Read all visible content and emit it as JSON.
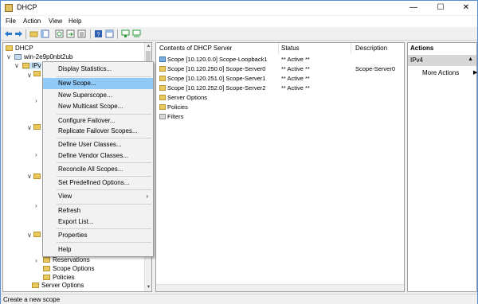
{
  "window": {
    "title": "DHCP"
  },
  "menubar": {
    "items": [
      "File",
      "Action",
      "View",
      "Help"
    ]
  },
  "toolbar": {
    "icons": [
      "back-arrow-icon",
      "forward-arrow-icon",
      "folder-icon",
      "console-tree-icon",
      "refresh-icon",
      "export-icon",
      "help-icon",
      "properties-icon",
      "add-server-icon",
      "network-icon"
    ]
  },
  "tree": {
    "root": "DHCP",
    "server": "win-2e9p0nbt2ub",
    "ipv4_partial": "IPv",
    "lower_items": [
      "Reservations",
      "Scope Options",
      "Policies",
      "Server Options"
    ]
  },
  "content": {
    "columns": [
      "Contents of DHCP Server",
      "Status",
      "Description"
    ],
    "rows": [
      {
        "name": "Scope [10.120.0.0] Scope-Loopback1",
        "status": "** Active **",
        "description": ""
      },
      {
        "name": "Scope [10.120.250.0] Scope-Server0",
        "status": "** Active **",
        "description": "Scope-Server0"
      },
      {
        "name": "Scope [10.120.251.0] Scope-Server1",
        "status": "** Active **",
        "description": ""
      },
      {
        "name": "Scope [10.120.252.0] Scope-Server2",
        "status": "** Active **",
        "description": ""
      },
      {
        "name": "Server Options",
        "status": "",
        "description": ""
      },
      {
        "name": "Policies",
        "status": "",
        "description": ""
      },
      {
        "name": "Filters",
        "status": "",
        "description": ""
      }
    ]
  },
  "actions": {
    "header": "Actions",
    "selected": "IPv4",
    "more": "More Actions"
  },
  "context_menu": {
    "items": [
      {
        "label": "Display Statistics...",
        "highlight": false
      },
      {
        "label": "New Scope...",
        "highlight": true
      },
      {
        "label": "New Superscope...",
        "highlight": false
      },
      {
        "label": "New Multicast Scope...",
        "highlight": false
      },
      {
        "label": "Configure Failover...",
        "highlight": false
      },
      {
        "label": "Replicate Failover Scopes...",
        "highlight": false
      },
      {
        "label": "Define User Classes...",
        "highlight": false
      },
      {
        "label": "Define Vendor Classes...",
        "highlight": false
      },
      {
        "label": "Reconcile All Scopes...",
        "highlight": false
      },
      {
        "label": "Set Predefined Options...",
        "highlight": false
      },
      {
        "label": "View",
        "highlight": false
      },
      {
        "label": "Refresh",
        "highlight": false
      },
      {
        "label": "Export List...",
        "highlight": false
      },
      {
        "label": "Properties",
        "highlight": false
      },
      {
        "label": "Help",
        "highlight": false
      }
    ]
  },
  "status": {
    "text": "Create a new scope"
  }
}
